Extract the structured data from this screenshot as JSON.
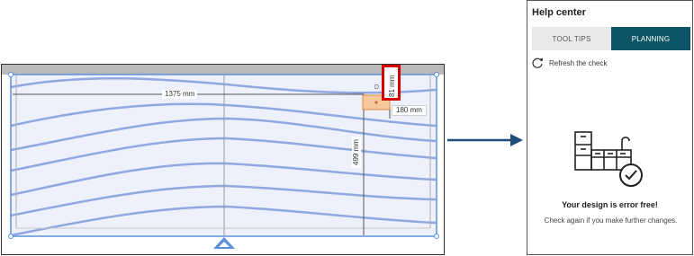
{
  "planner": {
    "dimension_width": "1375 mm",
    "dimension_depth_small": "180 mm",
    "dimension_height": "499 mm",
    "dimension_highlighted": "81 mm",
    "marker_letter": "D",
    "highlight_color": "#d40000",
    "selection_color": "#5b8fd9"
  },
  "arrow": {
    "color": "#1f4e79"
  },
  "help_center": {
    "title": "Help center",
    "tabs": [
      {
        "label": "TOOL TIPS",
        "active": false
      },
      {
        "label": "PLANNING",
        "active": true
      }
    ],
    "refresh_label": "Refresh the check",
    "status_title": "Your design is error free!",
    "status_description": "Check again if you make further changes.",
    "accent_color": "#0b5566"
  }
}
